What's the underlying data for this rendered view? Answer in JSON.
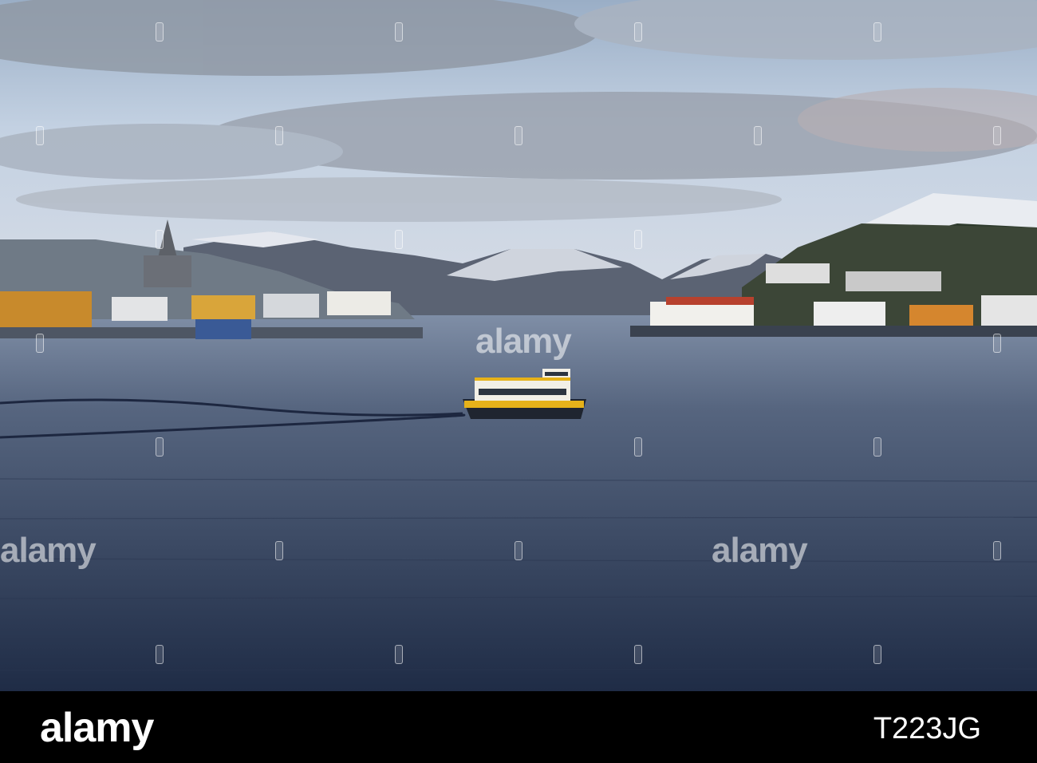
{
  "watermark": {
    "text": "alamy"
  },
  "footer": {
    "brand": "alamy",
    "image_code": "T223JG"
  },
  "colors": {
    "sky": "#c8d4e2",
    "water": "#3b4c66",
    "ferry_hull": "#e6b21a",
    "bar": "#000000"
  }
}
